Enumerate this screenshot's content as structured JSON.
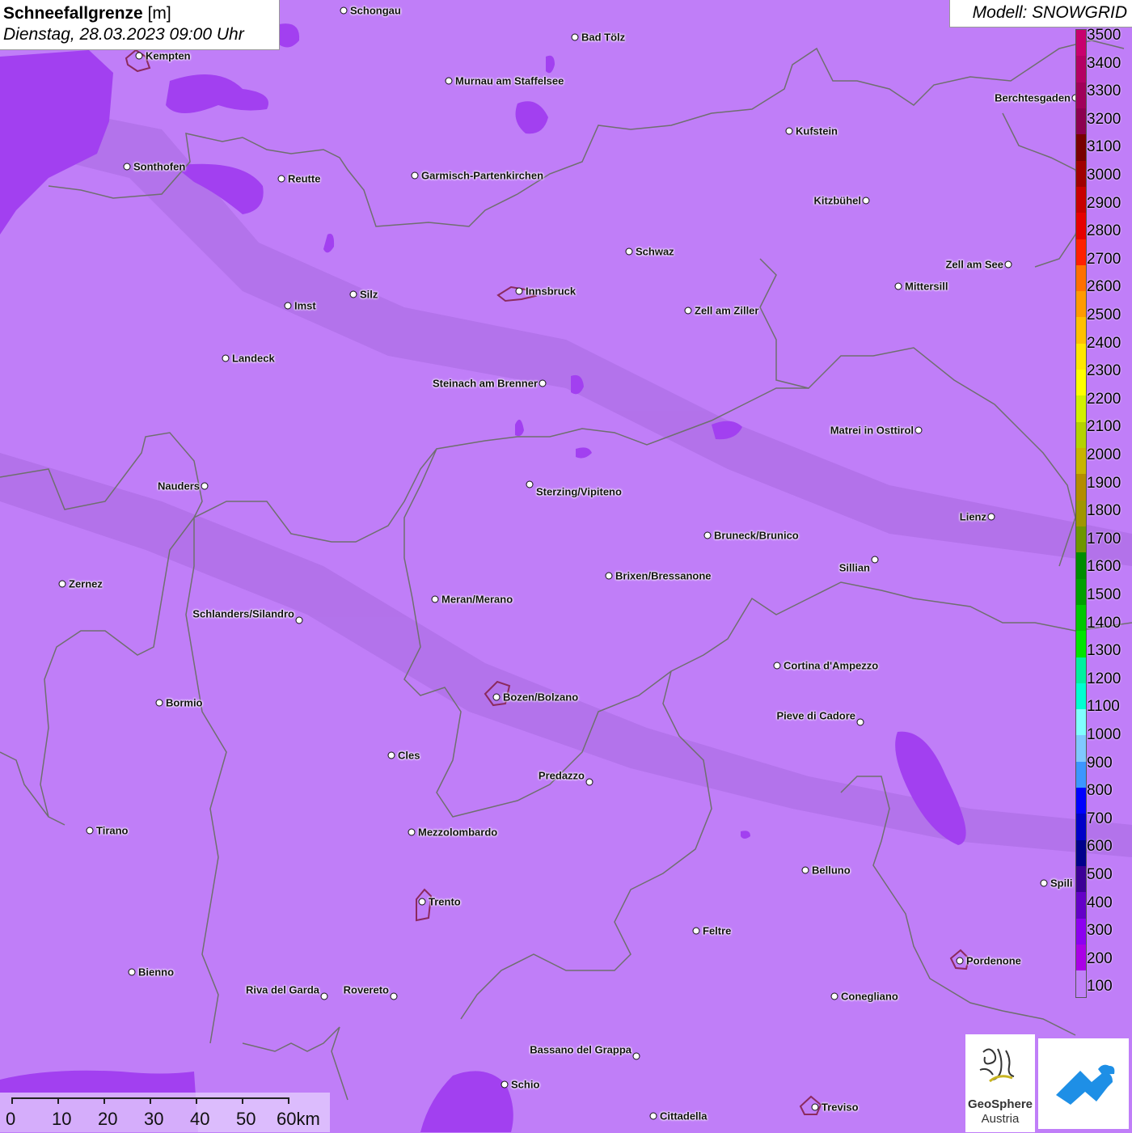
{
  "header": {
    "title_bold": "Schneefallgrenze",
    "title_unit": "[m]",
    "datetime": "Dienstag, 28.03.2023 09:00 Uhr",
    "model": "Modell: SNOWGRID"
  },
  "cities": [
    {
      "name": "Schongau"
    },
    {
      "name": "Bad Tölz"
    },
    {
      "name": "Kempten"
    },
    {
      "name": "Murnau am Staffelsee"
    },
    {
      "name": "Berchtesgaden"
    },
    {
      "name": "Kufstein"
    },
    {
      "name": "Sonthofen"
    },
    {
      "name": "Reutte"
    },
    {
      "name": "Garmisch-Partenkirchen"
    },
    {
      "name": "Kitzbühel"
    },
    {
      "name": "Schwaz"
    },
    {
      "name": "Zell am See"
    },
    {
      "name": "Innsbruck"
    },
    {
      "name": "Mittersill"
    },
    {
      "name": "Imst"
    },
    {
      "name": "Silz"
    },
    {
      "name": "Zell am Ziller"
    },
    {
      "name": "Landeck"
    },
    {
      "name": "Steinach am Brenner"
    },
    {
      "name": "Matrei in Osttirol"
    },
    {
      "name": "Nauders"
    },
    {
      "name": "Sterzing/Vipiteno"
    },
    {
      "name": "Lienz"
    },
    {
      "name": "Bruneck/Brunico"
    },
    {
      "name": "Sillian"
    },
    {
      "name": "Zernez"
    },
    {
      "name": "Brixen/Bressanone"
    },
    {
      "name": "Meran/Merano"
    },
    {
      "name": "Schlanders/Silandro"
    },
    {
      "name": "Cortina d'Ampezzo"
    },
    {
      "name": "Bozen/Bolzano"
    },
    {
      "name": "Bormio"
    },
    {
      "name": "Pieve di Cadore"
    },
    {
      "name": "Cles"
    },
    {
      "name": "Predazzo"
    },
    {
      "name": "Tirano"
    },
    {
      "name": "Mezzolombardo"
    },
    {
      "name": "Belluno"
    },
    {
      "name": "Spili"
    },
    {
      "name": "Trento"
    },
    {
      "name": "Feltre"
    },
    {
      "name": "Pordenone"
    },
    {
      "name": "Bienno"
    },
    {
      "name": "Riva del Garda"
    },
    {
      "name": "Rovereto"
    },
    {
      "name": "Conegliano"
    },
    {
      "name": "Bassano del Grappa"
    },
    {
      "name": "Schio"
    },
    {
      "name": "Treviso"
    },
    {
      "name": "Cittadella"
    }
  ],
  "legend": {
    "labels": [
      "3500",
      "3400",
      "3300",
      "3200",
      "3100",
      "3000",
      "2900",
      "2800",
      "2700",
      "2600",
      "2500",
      "2400",
      "2300",
      "2200",
      "2100",
      "2000",
      "1900",
      "1800",
      "1700",
      "1600",
      "1500",
      "1400",
      "1300",
      "1200",
      "1100",
      "1000",
      "900",
      "800",
      "700",
      "600",
      "500",
      "400",
      "300",
      "200",
      "100"
    ],
    "colors": [
      "#c8006e",
      "#b40064",
      "#a0005a",
      "#8c0050",
      "#780000",
      "#a00000",
      "#c80000",
      "#e60000",
      "#ff2000",
      "#ff7000",
      "#ff9a00",
      "#ffc000",
      "#ffe600",
      "#ffff00",
      "#d2f000",
      "#b4d200",
      "#c8b400",
      "#b48c00",
      "#a09600",
      "#6e9600",
      "#008c00",
      "#00a000",
      "#00c800",
      "#00e600",
      "#00f0a0",
      "#00ffd2",
      "#80ffff",
      "#80c8ff",
      "#3c96ff",
      "#0000ff",
      "#0000c8",
      "#00008c",
      "#3c0096",
      "#6400c8",
      "#8c00f0",
      "#aa00e6",
      "#c080f8"
    ]
  },
  "scale": {
    "labels": [
      "0",
      "10",
      "20",
      "30",
      "40",
      "50",
      "60km"
    ]
  },
  "logos": {
    "geosphere_line1": "GeoSphere",
    "geosphere_line2": "Austria"
  },
  "colors": {
    "background": "#c07ef8",
    "dark_patch": "#a240f0",
    "border": "#6f6f6f"
  }
}
